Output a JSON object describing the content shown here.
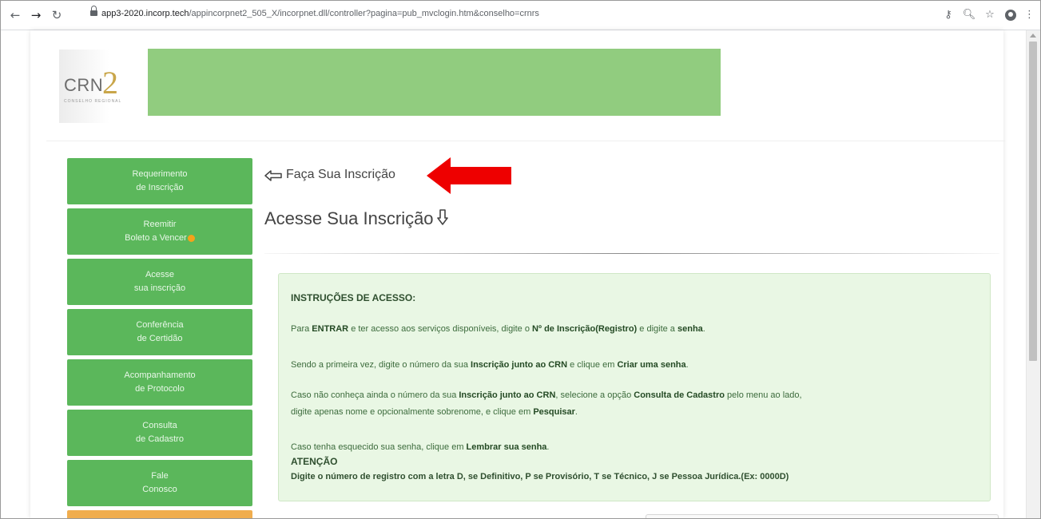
{
  "browser": {
    "url_host": "app3-2020.incorp.tech",
    "url_path": "/appincorpnet2_505_X/incorpnet.dll/controller?pagina=pub_mvclogin.htm&conselho=crnrs",
    "icons": [
      "back-icon",
      "forward-icon",
      "reload-icon",
      "lock-icon",
      "key-icon",
      "zoom-icon",
      "star-icon",
      "account-icon",
      "menu-icon"
    ]
  },
  "logo": {
    "text": "CRN",
    "number": "2",
    "sub": "CONSELHO REGIONAL"
  },
  "sidebar": {
    "items": [
      {
        "line1": "Requerimento",
        "line2": "de Inscrição"
      },
      {
        "line1": "Reemitir",
        "line2": "Boleto a Vencer"
      },
      {
        "line1": "Acesse",
        "line2": "sua inscrição"
      },
      {
        "line1": "Conferência",
        "line2": "de Certidão"
      },
      {
        "line1": "Acompanhamento",
        "line2": "de Protocolo"
      },
      {
        "line1": "Consulta",
        "line2": "de Cadastro"
      },
      {
        "line1": "Fale",
        "line2": "Conosco"
      }
    ]
  },
  "main": {
    "inscricao_link": "Faça Sua Inscrição",
    "acesse_title": "Acesse Sua Inscrição"
  },
  "instructions": {
    "title": "INSTRUÇÕES DE ACESSO:",
    "l1_a": "Para ",
    "l1_b": "ENTRAR",
    "l1_c": " e ter acesso aos serviços disponíveis, digite o ",
    "l1_d": "Nº de Inscrição(Registro)",
    "l1_e": " e digite a ",
    "l1_f": "senha",
    "l1_g": ".",
    "l2_a": "Sendo a primeira vez, digite o número da sua ",
    "l2_b": "Inscrição junto ao CRN",
    "l2_c": " e clique em ",
    "l2_d": "Criar uma senha",
    "l2_e": ".",
    "l3_a": "Caso não conheça ainda o número da sua ",
    "l3_b": "Inscrição junto ao CRN",
    "l3_c": ", selecione a opção ",
    "l3_d": "Consulta de Cadastro",
    "l3_e": " pelo menu ao lado,",
    "l3b_a": "digite apenas nome e opcionalmente sobrenome, e clique em ",
    "l3b_b": "Pesquisar",
    "l3b_c": ".",
    "l4_a": "Caso tenha esquecido sua senha, clique em ",
    "l4_b": "Lembrar sua senha",
    "l4_c": ".",
    "l5": "ATENÇÃO",
    "l6": "Digite o número de registro com a letra D, se Definitivo, P se Provisório, T se Técnico, J se Pessoa Jurídica.(Ex: 0000D)"
  },
  "colors": {
    "sidebar_green": "#5bb75b",
    "banner_green": "#91cc7f",
    "panel_bg": "#e9f7e4",
    "annotation_red": "#ee0000",
    "sidebar_orange": "#f0ad4e"
  }
}
